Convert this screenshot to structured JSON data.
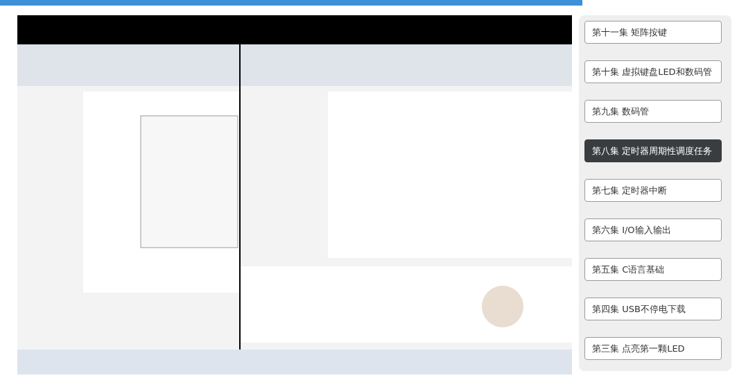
{
  "episodes": [
    {
      "label": "第十一集 矩阵按键",
      "selected": false
    },
    {
      "label": "第十集 虚拟键盘LED和数码管",
      "selected": false
    },
    {
      "label": "第九集 数码管",
      "selected": false
    },
    {
      "label": "第八集 定时器周期性调度任务",
      "selected": true
    },
    {
      "label": "第七集 定时器中断",
      "selected": false
    },
    {
      "label": "第六集 I/O输入输出",
      "selected": false
    },
    {
      "label": "第五集 C语言基础",
      "selected": false
    },
    {
      "label": "第四集 USB不停电下载",
      "selected": false
    },
    {
      "label": "第三集 点亮第一颗LED",
      "selected": false
    }
  ]
}
